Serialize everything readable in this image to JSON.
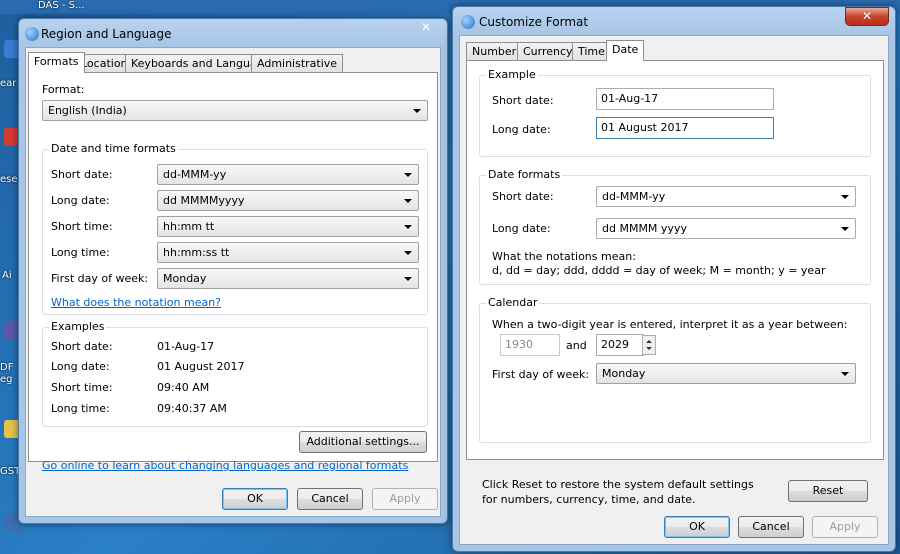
{
  "desktop": {
    "labels": [
      "DAS - S...",
      "ear",
      "ese",
      "Ai",
      "DF",
      "eg",
      "GST"
    ]
  },
  "region_dialog": {
    "title": "Region and Language",
    "tabs": [
      "Formats",
      "Location",
      "Keyboards and Languages",
      "Administrative"
    ],
    "format_label": "Format:",
    "format_value": "English (India)",
    "datetime_group": "Date and time formats",
    "rows": [
      {
        "label": "Short date:",
        "value": "dd-MMM-yy"
      },
      {
        "label": "Long date:",
        "value": "dd MMMMyyyy"
      },
      {
        "label": "Short time:",
        "value": "hh:mm tt"
      },
      {
        "label": "Long time:",
        "value": "hh:mm:ss tt"
      },
      {
        "label": "First day of week:",
        "value": "Monday"
      }
    ],
    "notation_link": "What does the notation mean?",
    "examples_group": "Examples",
    "examples": [
      {
        "label": "Short date:",
        "value": "01-Aug-17"
      },
      {
        "label": "Long date:",
        "value": "01 August 2017"
      },
      {
        "label": "Short time:",
        "value": "09:40 AM"
      },
      {
        "label": "Long time:",
        "value": "09:40:37 AM"
      }
    ],
    "additional_button": "Additional settings...",
    "online_link": "Go online to learn about changing languages and regional formats",
    "buttons": {
      "ok": "OK",
      "cancel": "Cancel",
      "apply": "Apply"
    }
  },
  "customize_dialog": {
    "title": "Customize Format",
    "tabs": [
      "Numbers",
      "Currency",
      "Time",
      "Date"
    ],
    "example_group": "Example",
    "short_date_label": "Short date:",
    "short_date_example": "01-Aug-17",
    "long_date_label": "Long date:",
    "long_date_example": "01 August 2017",
    "formats_group": "Date formats",
    "short_date_format": "dd-MMM-yy",
    "long_date_format": "dd MMMM yyyy",
    "notation_heading": "What the notations mean:",
    "notation_text": "d, dd = day;  ddd, dddd = day of week;  M = month;  y = year",
    "calendar_group": "Calendar",
    "calendar_text": "When a two-digit year is entered, interpret it as a year between:",
    "year_from": "1930",
    "and_label": "and",
    "year_to": "2029",
    "first_day_label": "First day of week:",
    "first_day_value": "Monday",
    "reset_text": "Click Reset to restore the system default settings for numbers, currency, time, and date.",
    "reset_button": "Reset",
    "buttons": {
      "ok": "OK",
      "cancel": "Cancel",
      "apply": "Apply"
    }
  }
}
